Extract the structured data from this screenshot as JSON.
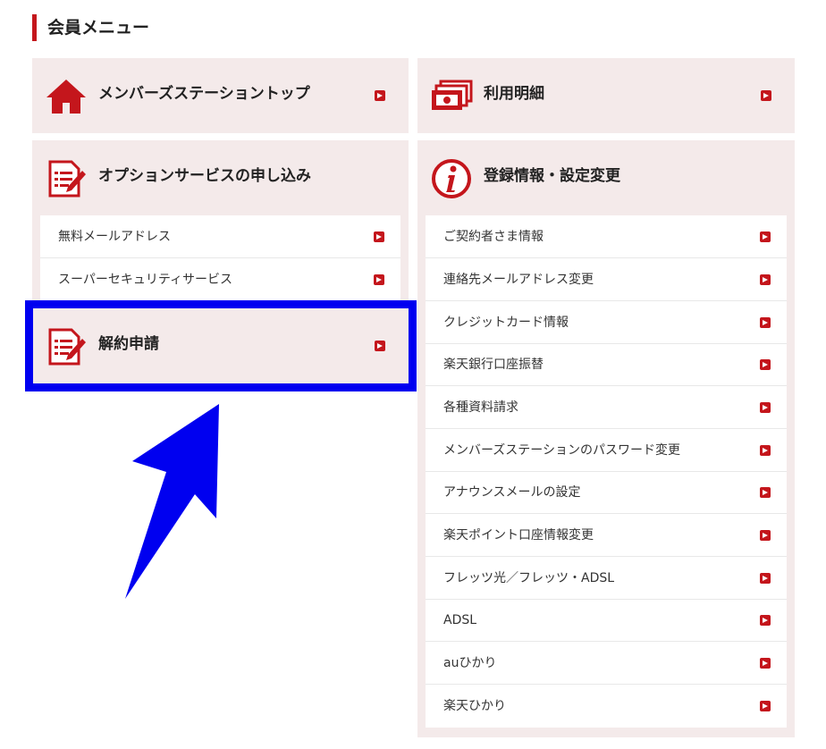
{
  "section_title": "会員メニュー",
  "colors": {
    "brand_red": "#c4161c",
    "panel_bg": "#f4eaea",
    "highlight_blue": "#0000f0"
  },
  "panels": {
    "member_top": {
      "label": "メンバーズステーショントップ",
      "icon": "house-icon"
    },
    "usage": {
      "label": "利用明細",
      "icon": "cash-stack-icon"
    },
    "option": {
      "label": "オプションサービスの申し込み",
      "icon": "document-pen-icon",
      "items": [
        "無料メールアドレス",
        "スーパーセキュリティサービス"
      ]
    },
    "cancel": {
      "label": "解約申請",
      "icon": "document-pen-icon"
    },
    "registration": {
      "label": "登録情報・設定変更",
      "icon": "info-circle-icon",
      "items": [
        "ご契約者さま情報",
        "連絡先メールアドレス変更",
        "クレジットカード情報",
        "楽天銀行口座振替",
        "各種資料請求",
        "メンバーズステーションのパスワード変更",
        "アナウンスメールの設定",
        "楽天ポイント口座情報変更",
        "フレッツ光／フレッツ・ADSL",
        "ADSL",
        "auひかり",
        "楽天ひかり"
      ]
    }
  }
}
